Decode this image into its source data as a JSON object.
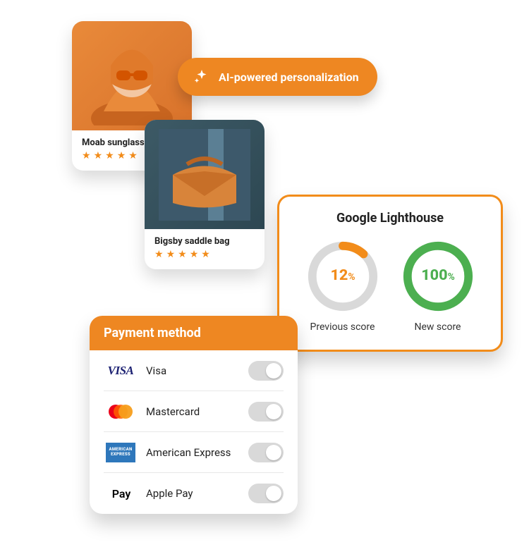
{
  "badge": {
    "label": "AI-powered personalization",
    "icon": "sparkles-icon"
  },
  "products": [
    {
      "name": "Moab sunglasses",
      "rating": 5,
      "image": "woman-orange-sunglasses"
    },
    {
      "name": "Bigsby saddle bag",
      "rating": 5,
      "image": "orange-saddle-bag"
    }
  ],
  "lighthouse": {
    "title": "Google Lighthouse",
    "previous": {
      "value": 12,
      "unit": "%",
      "label": "Previous score",
      "color": "#f28c1a"
    },
    "new": {
      "value": 100,
      "unit": "%",
      "label": "New score",
      "color": "#4caf50"
    }
  },
  "payment": {
    "title": "Payment method",
    "methods": [
      {
        "id": "visa",
        "label": "Visa",
        "logo": "visa-logo",
        "enabled": false
      },
      {
        "id": "mastercard",
        "label": "Mastercard",
        "logo": "mastercard-logo",
        "enabled": false
      },
      {
        "id": "amex",
        "label": "American Express",
        "logo": "amex-logo",
        "enabled": false
      },
      {
        "id": "applepay",
        "label": "Apple Pay",
        "logo": "apple-pay-logo",
        "enabled": false
      }
    ],
    "amex_lines": {
      "l1": "AMERICAN",
      "l2": "EXPRESS"
    },
    "visa_text": "VISA",
    "applepay_text": "Pay"
  }
}
